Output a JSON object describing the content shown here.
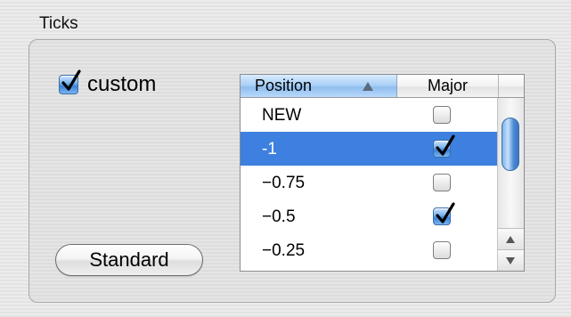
{
  "group": {
    "title": "Ticks"
  },
  "custom": {
    "label": "custom",
    "checked": true
  },
  "standard_button": {
    "label": "Standard"
  },
  "table": {
    "columns": [
      "Position",
      "Major"
    ],
    "sort_icon": "sort-ascending-icon",
    "rows": [
      {
        "position": "NEW",
        "major": false,
        "selected": false
      },
      {
        "position": "-1",
        "major": true,
        "selected": true
      },
      {
        "position": "−0.75",
        "major": false,
        "selected": false
      },
      {
        "position": "−0.5",
        "major": true,
        "selected": false
      },
      {
        "position": "−0.25",
        "major": false,
        "selected": false
      }
    ]
  },
  "colors": {
    "selection": "#3d80df",
    "accent": "#3b82d6"
  }
}
